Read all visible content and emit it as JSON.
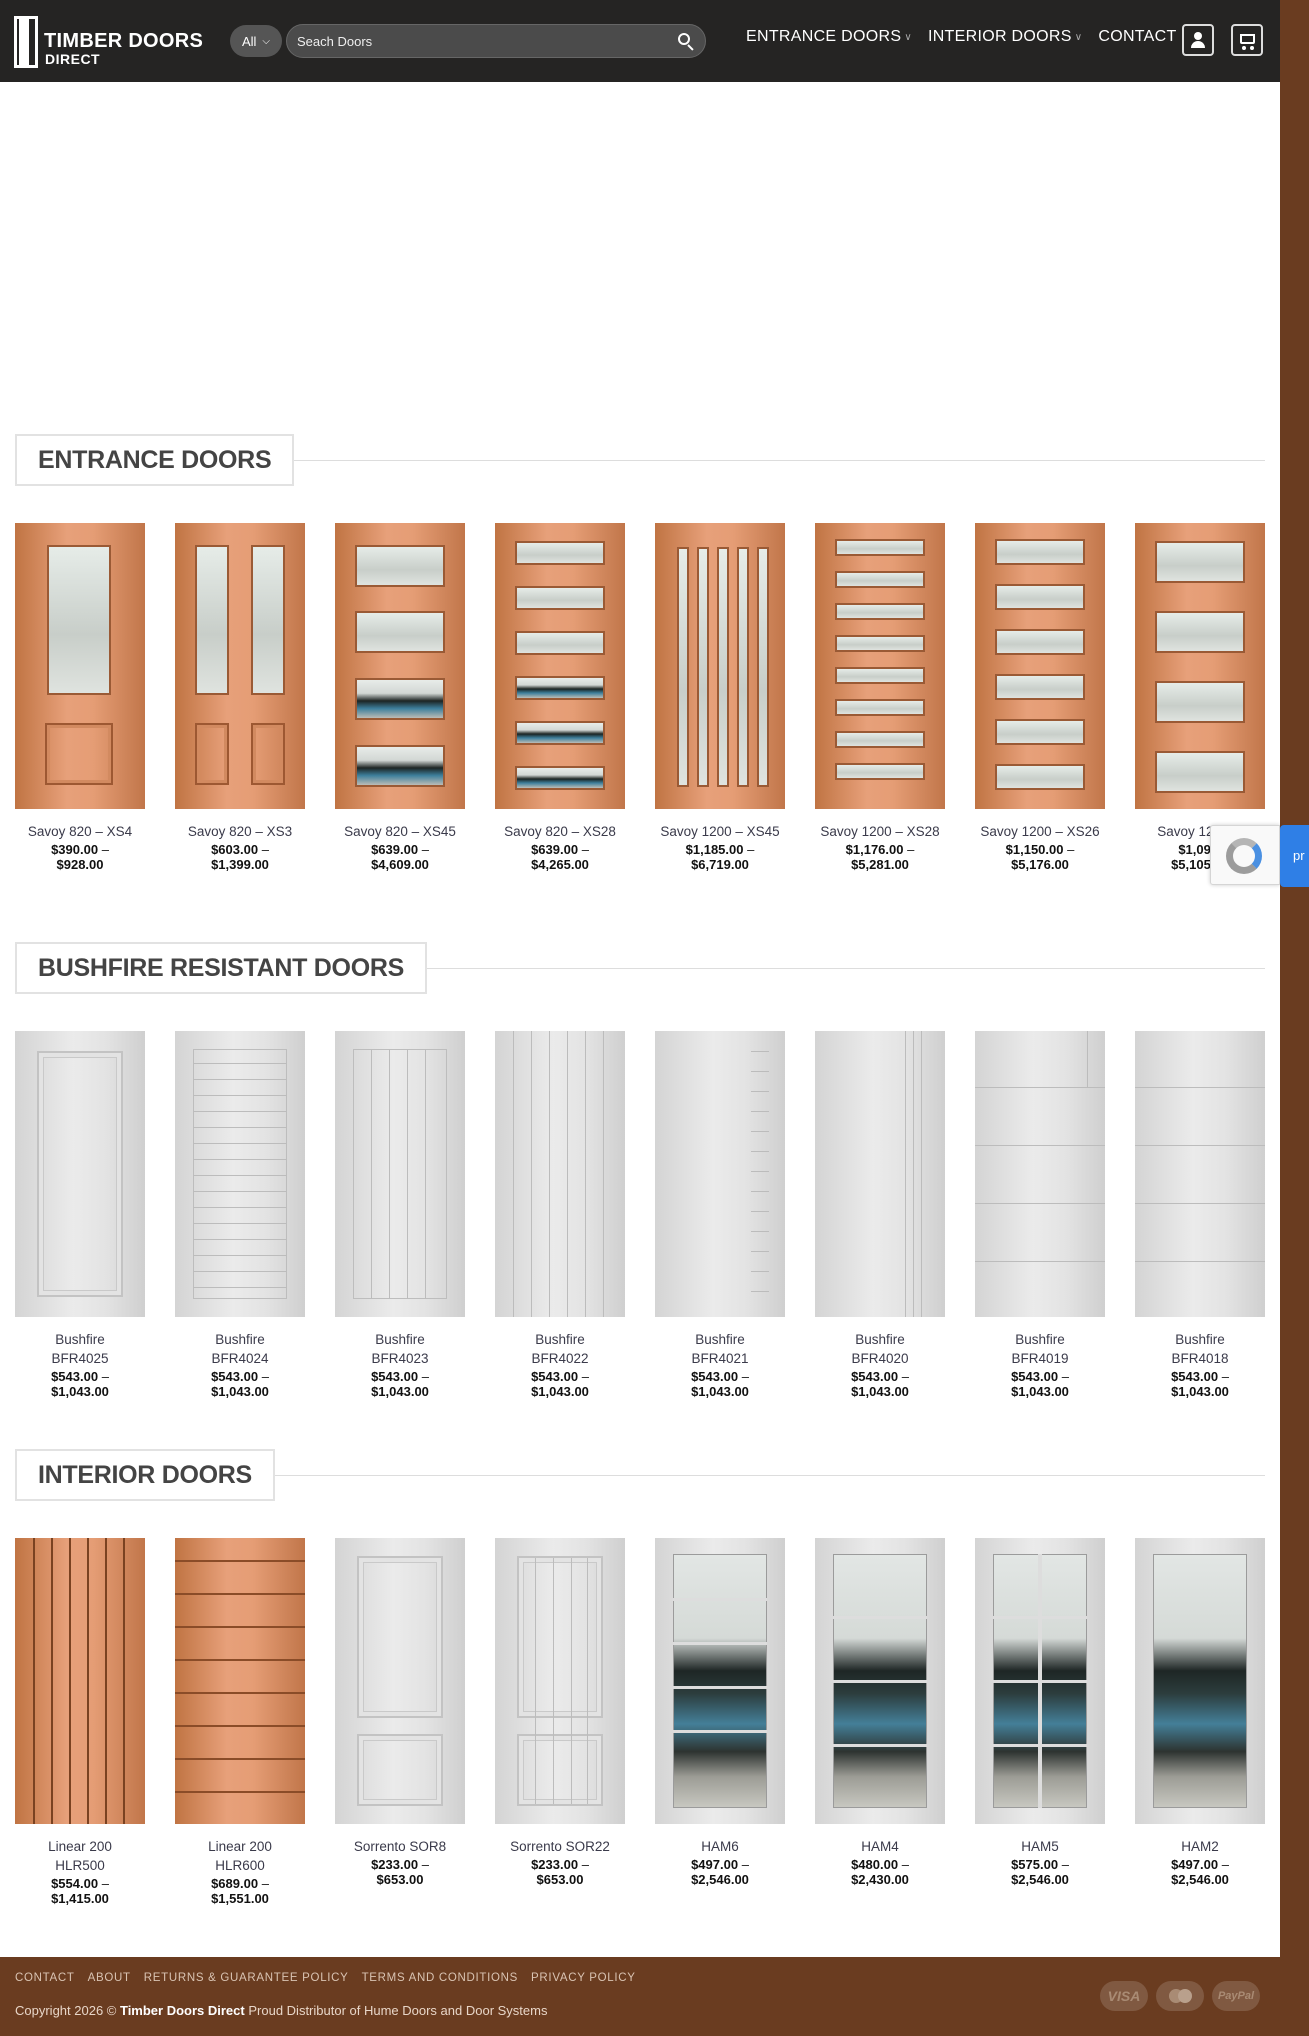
{
  "header": {
    "logo_line1": "TIMBER DOORS",
    "logo_line2": "DIRECT",
    "category_select": "All",
    "search_placeholder": "Seach Doors",
    "nav": [
      "ENTRANCE DOORS",
      "INTERIOR DOORS",
      "CONTACT"
    ]
  },
  "sections": [
    {
      "title": "ENTRANCE DOORS",
      "products": [
        {
          "name": "Savoy 820 – XS4",
          "price_low": "$390.00",
          "price_high": "$928.00"
        },
        {
          "name": "Savoy 820 – XS3",
          "price_low": "$603.00",
          "price_high": "$1,399.00"
        },
        {
          "name": "Savoy 820 – XS45",
          "price_low": "$639.00",
          "price_high": "$4,609.00"
        },
        {
          "name": "Savoy 820 – XS28",
          "price_low": "$639.00",
          "price_high": "$4,265.00"
        },
        {
          "name": "Savoy 1200 – XS45",
          "price_low": "$1,185.00",
          "price_high": "$6,719.00"
        },
        {
          "name": "Savoy 1200 – XS28",
          "price_low": "$1,176.00",
          "price_high": "$5,281.00"
        },
        {
          "name": "Savoy 1200 – XS26",
          "price_low": "$1,150.00",
          "price_high": "$5,176.00"
        },
        {
          "name": "Savoy 12 XS2",
          "price_low": "$1,099.",
          "price_high": "$5,105.00"
        }
      ]
    },
    {
      "title": "BUSHFIRE RESISTANT DOORS",
      "products": [
        {
          "name": "Bushfire BFR4025",
          "price_low": "$543.00",
          "price_high": "$1,043.00"
        },
        {
          "name": "Bushfire BFR4024",
          "price_low": "$543.00",
          "price_high": "$1,043.00"
        },
        {
          "name": "Bushfire BFR4023",
          "price_low": "$543.00",
          "price_high": "$1,043.00"
        },
        {
          "name": "Bushfire BFR4022",
          "price_low": "$543.00",
          "price_high": "$1,043.00"
        },
        {
          "name": "Bushfire BFR4021",
          "price_low": "$543.00",
          "price_high": "$1,043.00"
        },
        {
          "name": "Bushfire BFR4020",
          "price_low": "$543.00",
          "price_high": "$1,043.00"
        },
        {
          "name": "Bushfire BFR4019",
          "price_low": "$543.00",
          "price_high": "$1,043.00"
        },
        {
          "name": "Bushfire BFR4018",
          "price_low": "$543.00",
          "price_high": "$1,043.00"
        }
      ]
    },
    {
      "title": "INTERIOR DOORS",
      "products": [
        {
          "name": "Linear 200 HLR500",
          "price_low": "$554.00",
          "price_high": "$1,415.00"
        },
        {
          "name": "Linear 200 HLR600",
          "price_low": "$689.00",
          "price_high": "$1,551.00"
        },
        {
          "name": "Sorrento SOR8",
          "price_low": "$233.00",
          "price_high": "$653.00"
        },
        {
          "name": "Sorrento SOR22",
          "price_low": "$233.00",
          "price_high": "$653.00"
        },
        {
          "name": "HAM6",
          "price_low": "$497.00",
          "price_high": "$2,546.00"
        },
        {
          "name": "HAM4",
          "price_low": "$480.00",
          "price_high": "$2,430.00"
        },
        {
          "name": "HAM5",
          "price_low": "$575.00",
          "price_high": "$2,546.00"
        },
        {
          "name": "HAM2",
          "price_low": "$497.00",
          "price_high": "$2,546.00"
        }
      ]
    }
  ],
  "price_separator": "–",
  "footer": {
    "links": [
      "CONTACT",
      "ABOUT",
      "RETURNS & GUARANTEE POLICY",
      "TERMS AND CONDITIONS",
      "PRIVACY POLICY"
    ],
    "copyright_prefix": "Copyright 2026 ©",
    "copyright_brand": "Timber Doors Direct",
    "copyright_suffix": "Proud Distributor of Hume Doors and Door Systems",
    "payments": [
      "VISA",
      "mastercard",
      "PayPal"
    ]
  },
  "feedback_tab_label": "pr",
  "colors": {
    "header_bg": "#252423",
    "footer_bg": "#6a3c20",
    "feedback_tab": "#2f7fe6"
  }
}
